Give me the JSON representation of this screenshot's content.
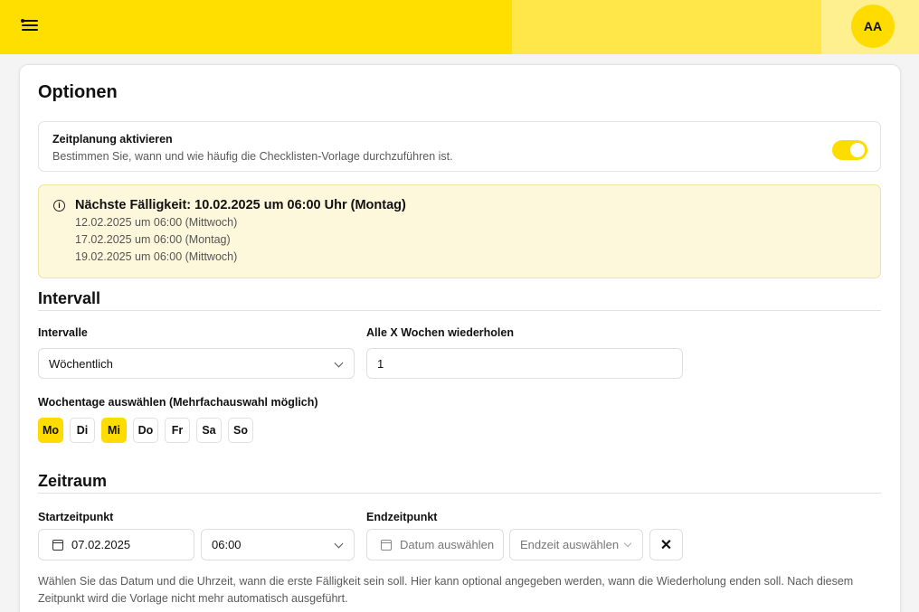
{
  "header": {
    "avatar_initials": "AA"
  },
  "options": {
    "title": "Optionen",
    "scheduling": {
      "title": "Zeitplanung aktivieren",
      "description": "Bestimmen Sie, wann und wie häufig die Checklisten-Vorlage durchzuführen ist.",
      "enabled": true
    },
    "next_due": {
      "main": "Nächste Fälligkeit: 10.02.2025 um 06:00 Uhr (Montag)",
      "upcoming": [
        "12.02.2025 um 06:00 (Mittwoch)",
        "17.02.2025 um 06:00 (Montag)",
        "19.02.2025 um 06:00 (Mittwoch)"
      ]
    }
  },
  "interval": {
    "section_title": "Intervall",
    "interval_label": "Intervalle",
    "interval_value": "Wöchentlich",
    "repeat_label": "Alle X Wochen wiederholen",
    "repeat_value": "1",
    "weekdays_label": "Wochentage auswählen (Mehrfachauswahl möglich)",
    "weekdays": [
      {
        "label": "Mo",
        "selected": true
      },
      {
        "label": "Di",
        "selected": false
      },
      {
        "label": "Mi",
        "selected": true
      },
      {
        "label": "Do",
        "selected": false
      },
      {
        "label": "Fr",
        "selected": false
      },
      {
        "label": "Sa",
        "selected": false
      },
      {
        "label": "So",
        "selected": false
      }
    ]
  },
  "timeframe": {
    "section_title": "Zeitraum",
    "start_label": "Startzeitpunkt",
    "start_date": "07.02.2025",
    "start_time": "06:00",
    "end_label": "Endzeitpunkt",
    "end_date_placeholder": "Datum auswählen",
    "end_time_placeholder": "Endzeit auswählen",
    "clear_symbol": "✕",
    "help_text": "Wählen Sie das Datum und die Uhrzeit, wann die erste Fälligkeit sein soll. Hier kann optional angegeben werden, wann die Wiederholung enden soll. Nach diesem Zeitpunkt wird die Vorlage nicht mehr automatisch ausgeführt."
  },
  "colors": {
    "accent": "#ffdc00",
    "header_yellow": "#ffdf00",
    "info_background": "#fdf8dc"
  },
  "icons": [
    "menu-icon",
    "info-icon",
    "chevron-down-icon",
    "calendar-icon",
    "close-icon"
  ]
}
